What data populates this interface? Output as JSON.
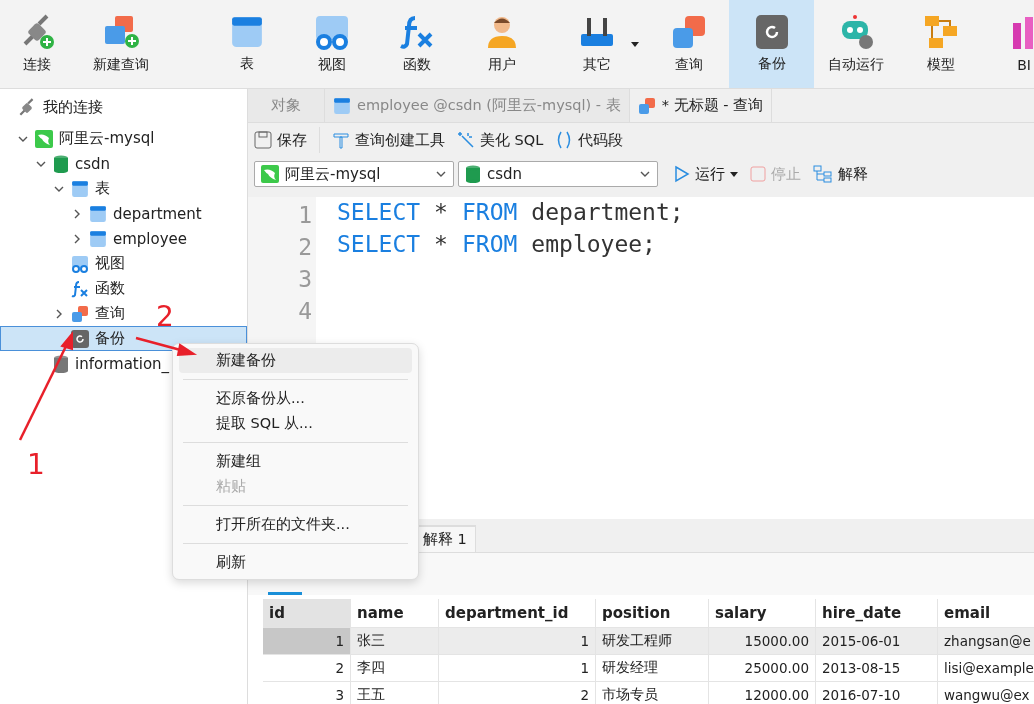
{
  "toolbar": {
    "items": [
      {
        "label": "连接",
        "selected": false
      },
      {
        "label": "新建查询",
        "selected": false
      },
      {
        "label": "表",
        "selected": false
      },
      {
        "label": "视图",
        "selected": false
      },
      {
        "label": "函数",
        "selected": false
      },
      {
        "label": "用户",
        "selected": false
      },
      {
        "label": "其它",
        "selected": false,
        "dropdown": true
      },
      {
        "label": "查询",
        "selected": false
      },
      {
        "label": "备份",
        "selected": true
      },
      {
        "label": "自动运行",
        "selected": false
      },
      {
        "label": "模型",
        "selected": false
      },
      {
        "label": "BI",
        "selected": false
      }
    ]
  },
  "sidebar": {
    "title": "我的连接",
    "tree": [
      {
        "label": "阿里云-mysql",
        "expanded": true,
        "selected": false,
        "children": [
          {
            "label": "csdn",
            "expanded": true,
            "selected": false,
            "children": [
              {
                "label": "表",
                "expanded": true,
                "selected": false,
                "children": [
                  {
                    "label": "department",
                    "expanded": false,
                    "selected": false
                  },
                  {
                    "label": "employee",
                    "expanded": false,
                    "selected": false
                  }
                ]
              },
              {
                "label": "视图",
                "selected": false
              },
              {
                "label": "函数",
                "selected": false
              },
              {
                "label": "查询",
                "expanded": false,
                "selected": false
              },
              {
                "label": "备份",
                "selected": true
              }
            ]
          },
          {
            "label": "information_",
            "selected": false
          }
        ]
      }
    ]
  },
  "tabs": [
    {
      "label": "对象",
      "selected": false
    },
    {
      "label": "employee @csdn (阿里云-mysql) - 表",
      "selected": false
    },
    {
      "label": "* 无标题 - 查询",
      "selected": true
    }
  ],
  "query_toolbar": {
    "buttons": [
      {
        "label": "保存",
        "disabled": false
      },
      {
        "label": "查询创建工具",
        "disabled": false
      },
      {
        "label": "美化 SQL",
        "disabled": false
      },
      {
        "label": "代码段",
        "disabled": false
      }
    ],
    "connection": "阿里云-mysql",
    "database": "csdn",
    "actions": [
      {
        "label": "运行",
        "disabled": false,
        "dropdown": true
      },
      {
        "label": "停止",
        "disabled": true
      },
      {
        "label": "解释",
        "disabled": false
      }
    ]
  },
  "editor": {
    "lines": [
      {
        "number": "1",
        "tokens": [
          {
            "text": "SELECT",
            "kind": "keyword"
          },
          {
            "text": "*",
            "kind": "plain"
          },
          {
            "text": "FROM",
            "kind": "keyword"
          },
          {
            "text": "department;",
            "kind": "plain"
          }
        ]
      },
      {
        "number": "2",
        "tokens": [
          {
            "text": "SELECT",
            "kind": "keyword"
          },
          {
            "text": "*",
            "kind": "plain"
          },
          {
            "text": "FROM",
            "kind": "keyword"
          },
          {
            "text": "employee;",
            "kind": "plain"
          }
        ]
      },
      {
        "number": "3"
      },
      {
        "number": "4"
      }
    ]
  },
  "result_tabs": [
    {
      "label": "解释 1",
      "selected": false
    }
  ],
  "result_subtabs": [
    {
      "selected": true
    }
  ],
  "table": {
    "columns": [
      "id",
      "name",
      "department_id",
      "position",
      "salary",
      "hire_date",
      "email"
    ],
    "rows": [
      {
        "selected": true,
        "cells": [
          "1",
          "张三",
          "1",
          "研发工程师",
          "15000.00",
          "2015-06-01",
          "zhangsan@e"
        ]
      },
      {
        "selected": false,
        "cells": [
          "2",
          "李四",
          "1",
          "研发经理",
          "25000.00",
          "2013-08-15",
          "lisi@example"
        ]
      },
      {
        "selected": false,
        "cells": [
          "3",
          "王五",
          "2",
          "市场专员",
          "12000.00",
          "2016-07-10",
          "wangwu@ex"
        ]
      }
    ]
  },
  "context_menu": {
    "items": [
      {
        "kind": "item",
        "label": "新建备份",
        "highlighted": true,
        "disabled": false
      },
      {
        "kind": "separator"
      },
      {
        "kind": "item",
        "label": "还原备份从...",
        "highlighted": false,
        "disabled": false
      },
      {
        "kind": "item",
        "label": "提取 SQL 从...",
        "highlighted": false,
        "disabled": false
      },
      {
        "kind": "separator"
      },
      {
        "kind": "item",
        "label": "新建组",
        "highlighted": false,
        "disabled": false
      },
      {
        "kind": "item",
        "label": "粘贴",
        "highlighted": false,
        "disabled": true
      },
      {
        "kind": "separator"
      },
      {
        "kind": "item",
        "label": "打开所在的文件夹...",
        "highlighted": false,
        "disabled": false
      },
      {
        "kind": "separator"
      },
      {
        "kind": "item",
        "label": "刷新",
        "highlighted": false,
        "disabled": false
      }
    ]
  },
  "annotations": [
    {
      "label": "1"
    },
    {
      "label": "2"
    }
  ]
}
